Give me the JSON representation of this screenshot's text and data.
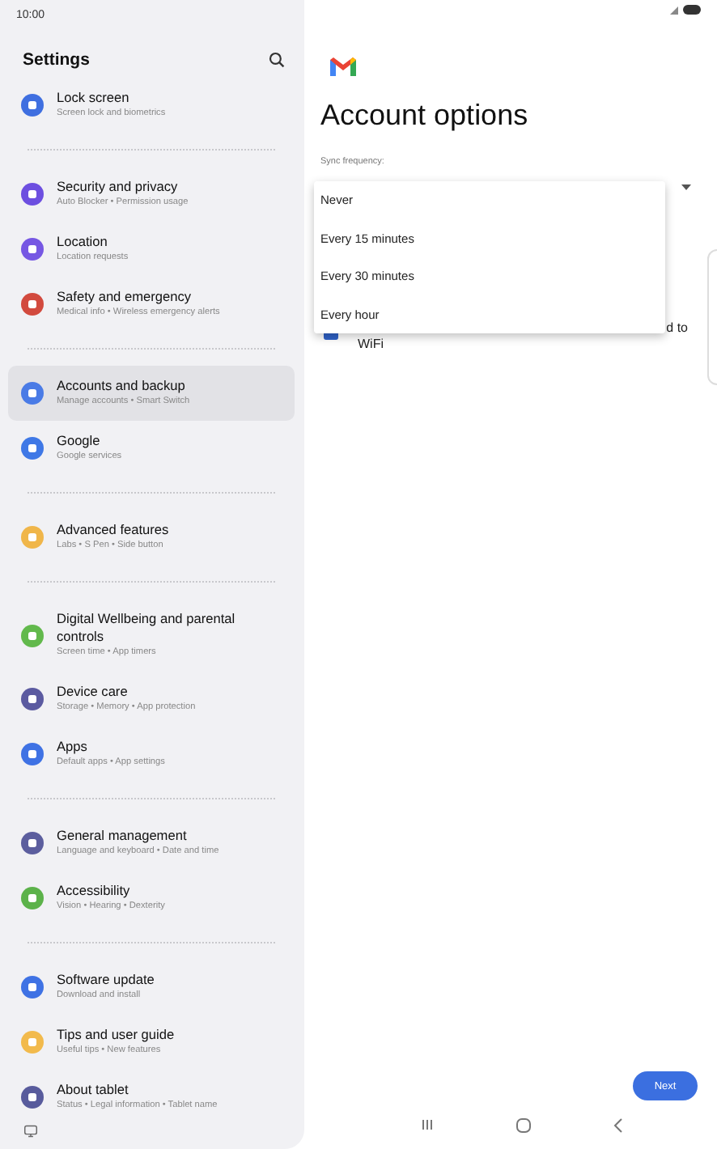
{
  "status_bar": {
    "time": "10:00"
  },
  "sidebar": {
    "title": "Settings",
    "groups": [
      [
        {
          "title": "Lock screen",
          "subtitle": "Screen lock and biometrics",
          "color": "#3f6fe0",
          "selected": false
        }
      ],
      [
        {
          "title": "Security and privacy",
          "subtitle": "Auto Blocker  •  Permission usage",
          "color": "#6d4fe0",
          "selected": false
        },
        {
          "title": "Location",
          "subtitle": "Location requests",
          "color": "#7657e3",
          "selected": false
        },
        {
          "title": "Safety and emergency",
          "subtitle": "Medical info  •  Wireless emergency alerts",
          "color": "#d24a3e",
          "selected": false
        }
      ],
      [
        {
          "title": "Accounts and backup",
          "subtitle": "Manage accounts  •  Smart Switch",
          "color": "#4a7be6",
          "selected": true
        },
        {
          "title": "Google",
          "subtitle": "Google services",
          "color": "#3f78e6",
          "selected": false
        }
      ],
      [
        {
          "title": "Advanced features",
          "subtitle": "Labs  •  S Pen  •  Side button",
          "color": "#f0b64a",
          "selected": false
        }
      ],
      [
        {
          "title": "Digital Wellbeing and parental controls",
          "subtitle": "Screen time  •  App timers",
          "color": "#62b94c",
          "selected": false
        },
        {
          "title": "Device care",
          "subtitle": "Storage  •  Memory  •  App protection",
          "color": "#5b5aa0",
          "selected": false
        },
        {
          "title": "Apps",
          "subtitle": "Default apps  •  App settings",
          "color": "#3f72e4",
          "selected": false
        }
      ],
      [
        {
          "title": "General management",
          "subtitle": "Language and keyboard  •  Date and time",
          "color": "#5c5e9e",
          "selected": false
        },
        {
          "title": "Accessibility",
          "subtitle": "Vision  •  Hearing  •  Dexterity",
          "color": "#5cb24a",
          "selected": false
        }
      ],
      [
        {
          "title": "Software update",
          "subtitle": "Download and install",
          "color": "#3f72e4",
          "selected": false
        },
        {
          "title": "Tips and user guide",
          "subtitle": "Useful tips  •  New features",
          "color": "#f2ba4c",
          "selected": false
        },
        {
          "title": "About tablet",
          "subtitle": "Status  •  Legal information  •  Tablet name",
          "color": "#585b9c",
          "selected": false
        }
      ]
    ]
  },
  "main": {
    "title": "Account options",
    "sync_label": "Sync frequency:",
    "menu": [
      "Never",
      "Every 15 minutes",
      "Every 30 minutes",
      "Every hour"
    ],
    "checkbox_row": {
      "label_end": "d to",
      "label_line_2": "WiFi"
    },
    "next_button": "Next"
  }
}
